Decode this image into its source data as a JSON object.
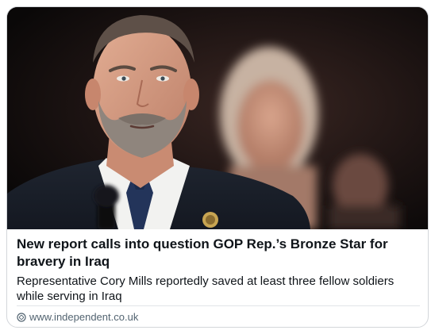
{
  "card": {
    "headline": "New report calls into question GOP Rep.’s Bronze Star for bravery in Iraq",
    "description": "Representative Cory Mills reportedly saved at least three fellow soldiers while serving in Iraq",
    "source_url": "www.independent.co.uk"
  },
  "icons": {
    "source": "link-icon"
  },
  "colors": {
    "headline": "#0f1419",
    "source": "#536471",
    "border": "#d3d6da"
  }
}
